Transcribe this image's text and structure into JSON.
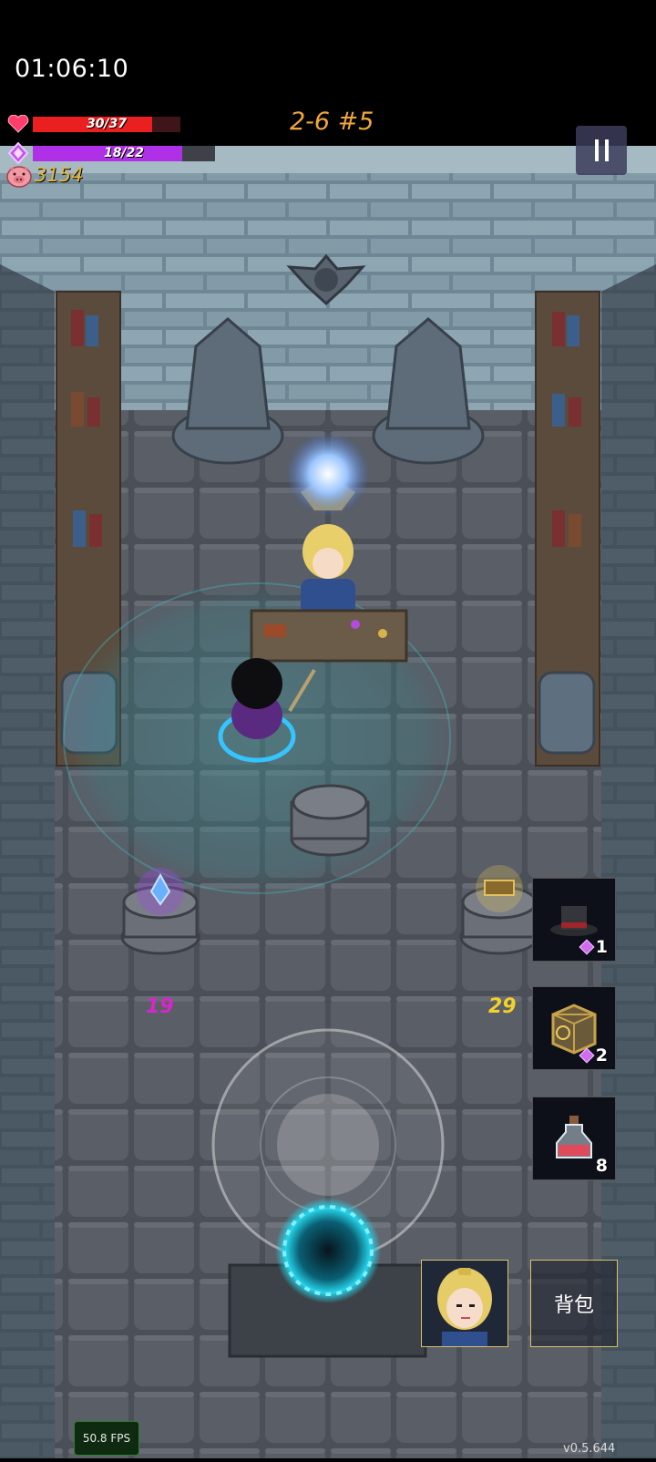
{
  "hud": {
    "clock": "01:06:10",
    "hp_text": "30/37",
    "hp_fraction": 0.811,
    "mp_text": "18/22",
    "mp_fraction": 0.818,
    "gold": "3154",
    "level": "2-6 #5"
  },
  "icons": {
    "heart": "heart-icon",
    "mana": "mana-gem-icon",
    "gold": "pig-icon",
    "pause": "pause-icon"
  },
  "scene": {
    "left_pedestal_price": "19",
    "right_pedestal_price": "29"
  },
  "items": [
    {
      "name": "top-hat",
      "cost": "1"
    },
    {
      "name": "rune-cube",
      "cost": "2"
    },
    {
      "name": "red-potion",
      "count": "8"
    }
  ],
  "bottom": {
    "bag_label": "背包"
  },
  "footer": {
    "fps": "50.8 FPS",
    "version": "v0.5.644"
  },
  "colors": {
    "hp": "#ea1f1f",
    "mp": "#b030e8",
    "gold": "#e6b73a",
    "level": "#f0a63a",
    "price_left": "#d926c8",
    "price_right": "#f2d22a"
  }
}
